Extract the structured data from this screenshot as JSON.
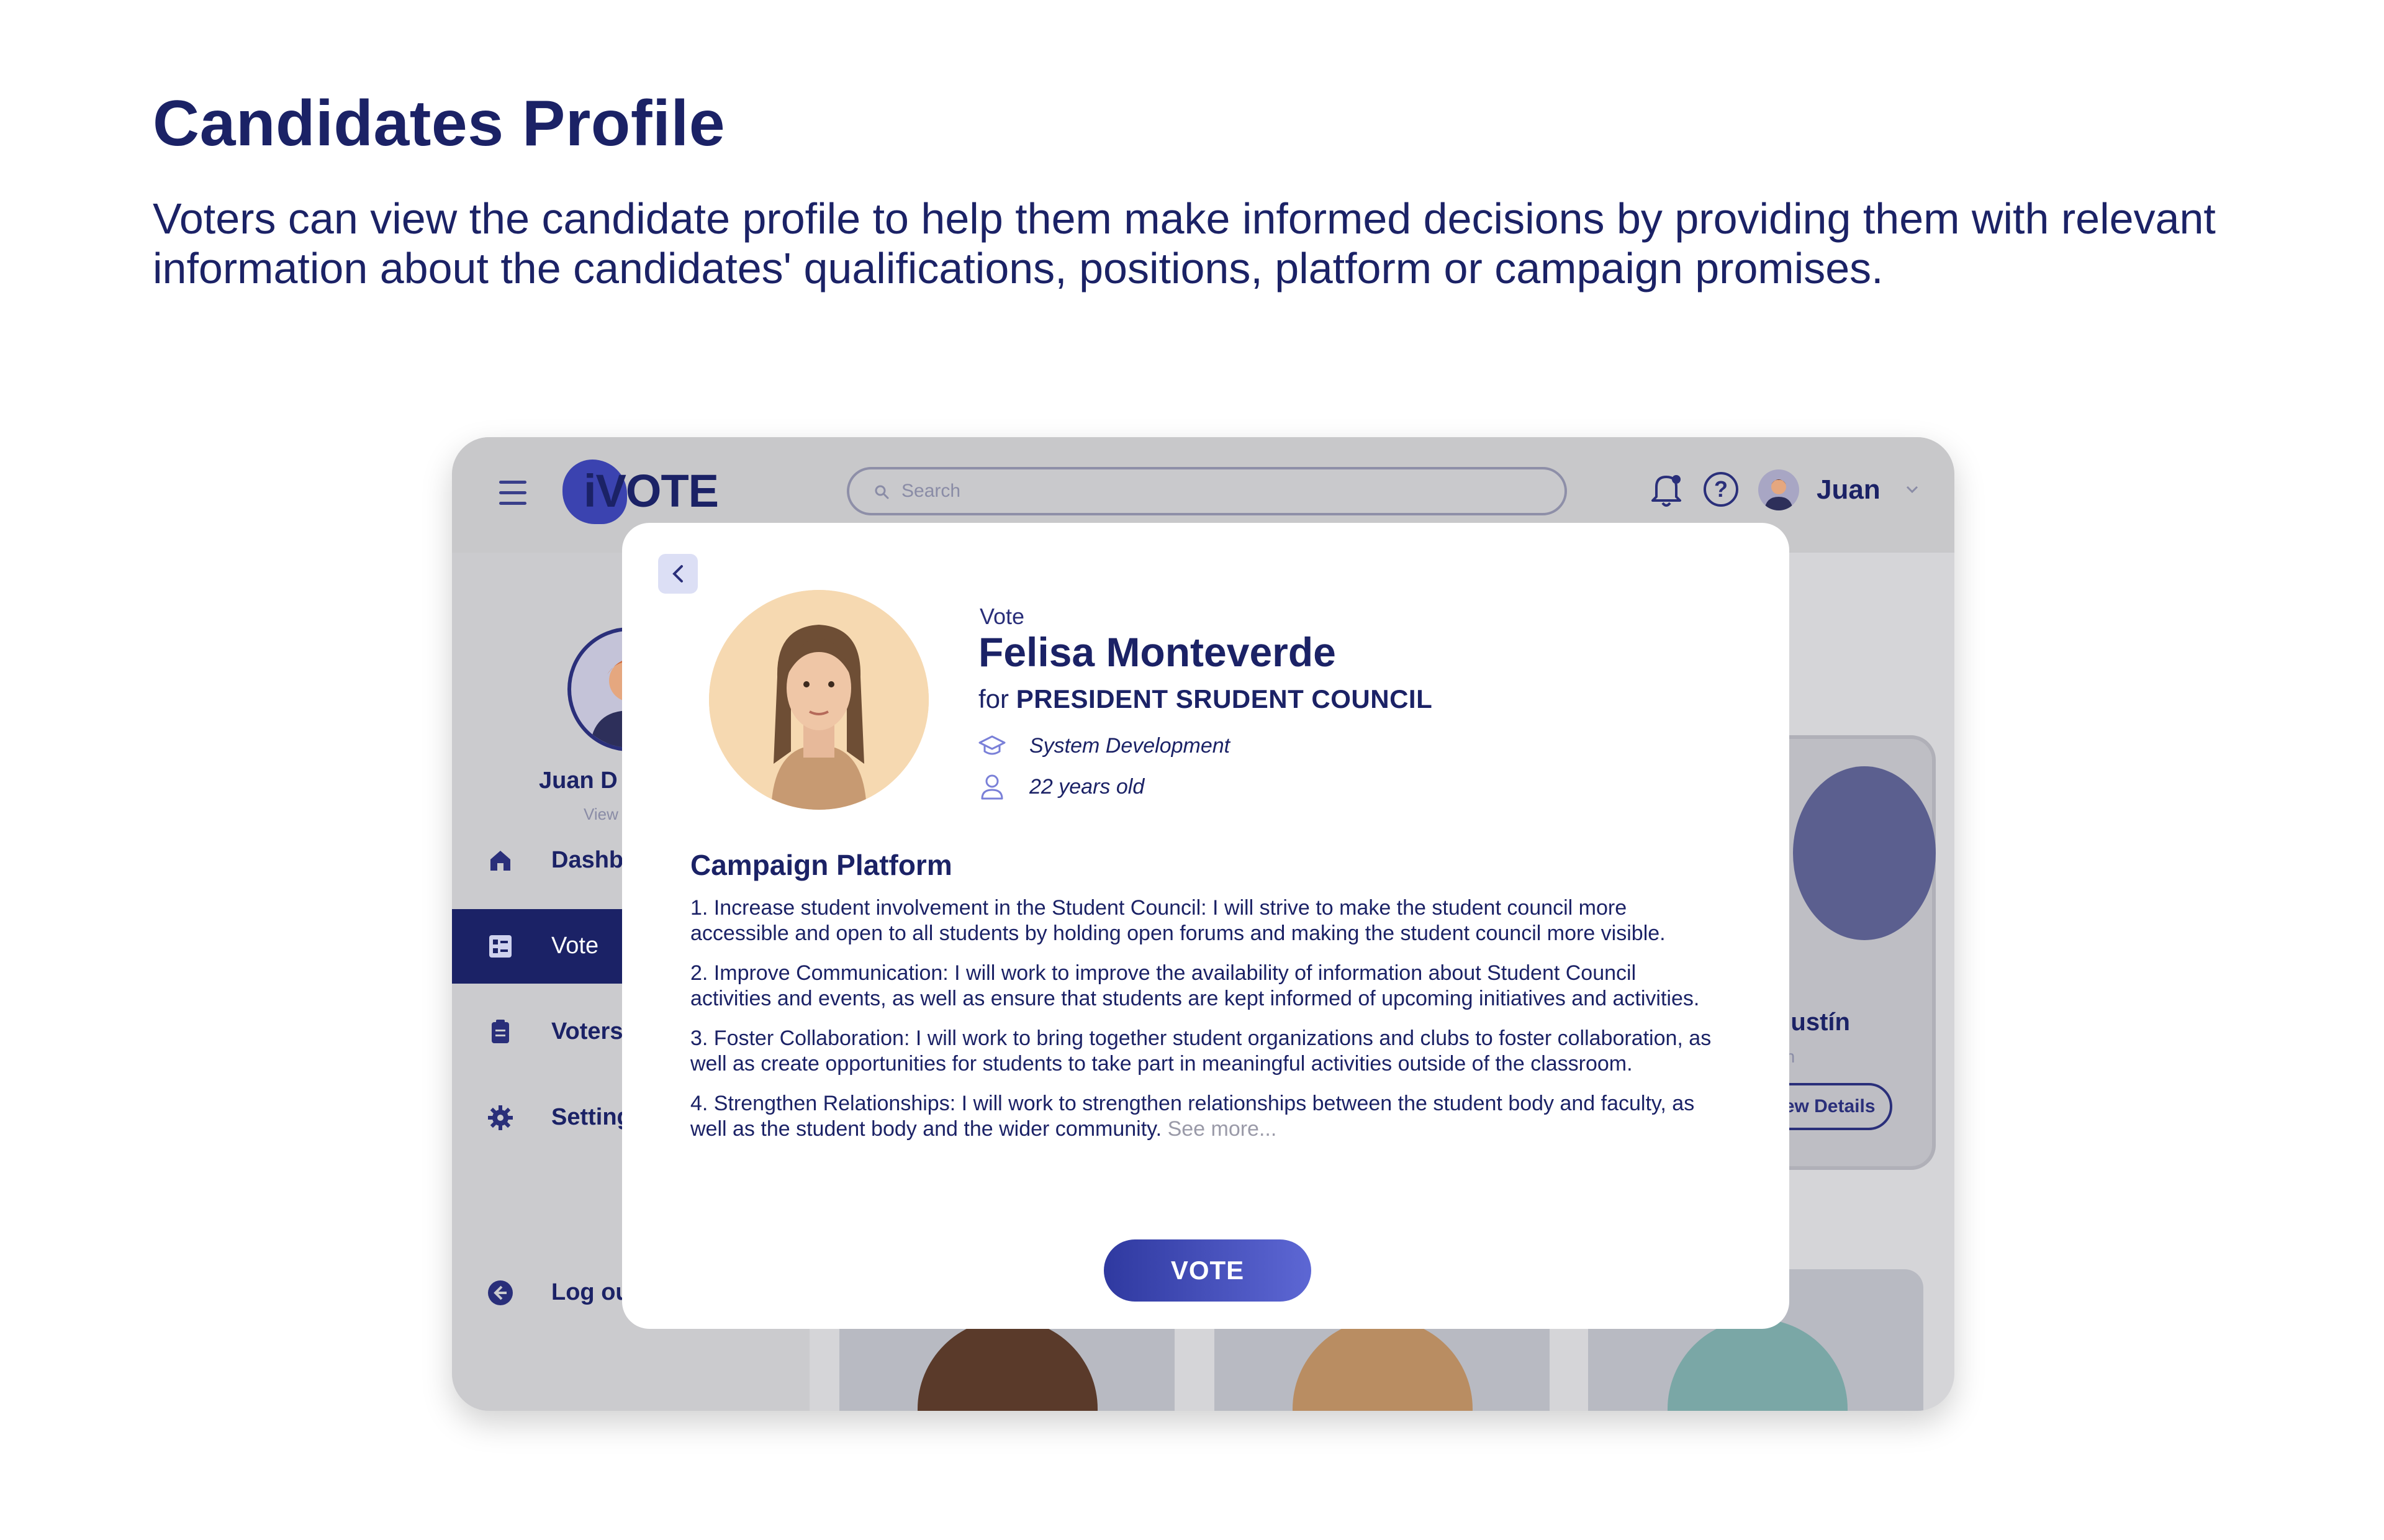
{
  "page": {
    "title": "Candidates Profile",
    "description": "Voters can view the candidate profile to help them make informed decisions by providing them with relevant information about the candidates' qualifications, positions, platform or campaign promises."
  },
  "header": {
    "logo": "iVOTE",
    "search_placeholder": "Search",
    "user_name": "Juan"
  },
  "sidebar": {
    "profile_name": "Juan D",
    "profile_link": "View",
    "items": [
      {
        "label": "Dashb",
        "icon": "home-icon"
      },
      {
        "label": "Vote",
        "icon": "ballot-list-icon",
        "active": true
      },
      {
        "label": "Voters",
        "icon": "clipboard-icon"
      },
      {
        "label": "Setting",
        "icon": "gear-icon"
      }
    ],
    "logout": "Log out"
  },
  "background_card": {
    "name": "gustín",
    "sub": "on",
    "button": "iew Details"
  },
  "modal": {
    "vote_label": "Vote",
    "candidate_name": "Felisa Monteverde",
    "for_prefix": "for",
    "position": "PRESIDENT SRUDENT COUNCIL",
    "course": "System Development",
    "age": "22 years old",
    "platform_title": "Campaign Platform",
    "platform": [
      "1. Increase student involvement in the Student Council: I will strive to make the student council more accessible and open to all students by holding open forums and making the student council more visible.",
      "2. Improve Communication: I will work to improve the availability of information about Student Council activities and events, as well as ensure that students are kept informed of upcoming initiatives and activities.",
      "3. Foster Collaboration: I will work to bring together student organizations and clubs to foster collaboration, as well as create opportunities for students to take part in meaningful activities outside of the classroom.",
      "4. Strengthen Relationships: I will work to strengthen relationships between the student body and faculty, as well as the student body and the wider community."
    ],
    "see_more": "See more...",
    "vote_button": "VOTE"
  },
  "colors": {
    "primary": "#1b2266",
    "accent": "#3b43b0",
    "overlay": "#c8c8ca"
  }
}
